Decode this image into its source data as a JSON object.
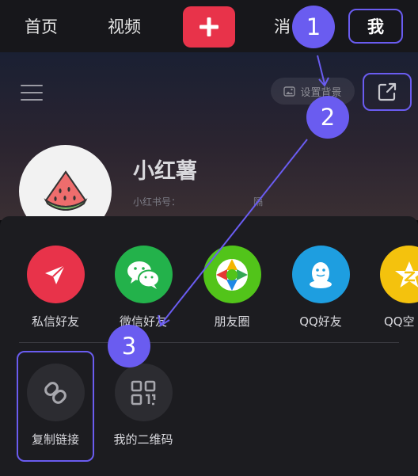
{
  "topbar": {
    "home": "首页",
    "video": "视频",
    "messages": "消",
    "me": "我"
  },
  "profile": {
    "set_background": "设置背景",
    "username": "小红薯",
    "user_id_label": "小红书号：",
    "user_id_tail": "隔"
  },
  "share_sheet": {
    "targets": [
      {
        "label": "私信好友",
        "color": "#e8334a",
        "icon": "paper-plane-icon"
      },
      {
        "label": "微信好友",
        "color": "#23b24b",
        "icon": "wechat-icon"
      },
      {
        "label": "朋友圈",
        "color": "#52c41a",
        "icon": "moments-aperture-icon"
      },
      {
        "label": "QQ好友",
        "color": "#1e9ee0",
        "icon": "qq-penguin-icon"
      },
      {
        "label": "QQ空",
        "color": "#f4c20d",
        "icon": "qzone-star-icon"
      }
    ],
    "actions": [
      {
        "label": "复制链接",
        "icon": "link-icon"
      },
      {
        "label": "我的二维码",
        "icon": "qr-code-icon"
      }
    ]
  },
  "annotations": {
    "steps": [
      "1",
      "2",
      "3"
    ],
    "accent": "#6a5cf0"
  }
}
